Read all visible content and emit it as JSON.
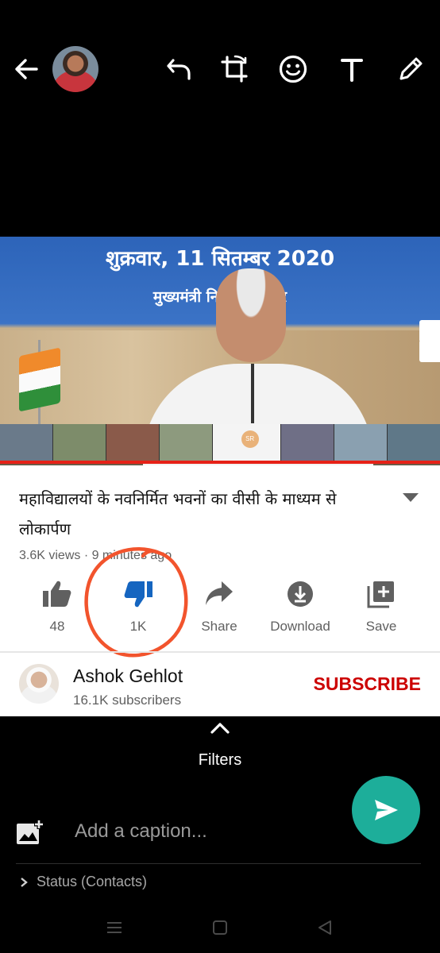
{
  "top_bar": {
    "back_icon": "arrow-left-icon",
    "profile_icon": "avatar",
    "tools": [
      "undo-icon",
      "crop-rotate-icon",
      "emoji-icon",
      "text-icon",
      "pencil-icon"
    ]
  },
  "video": {
    "banner_date": "शुक्रवार, 11 सितम्बर 2020",
    "banner_sub": "मुख्यमंत्री निवास, जयपुर",
    "progress": 1.0,
    "progress_color": "#e62117"
  },
  "details": {
    "title": "महाविद्यालयों के नवनिर्मित भवनों का वीसी के माध्यम से लोकार्पण",
    "meta": "3.6K views · 9 minutes ago",
    "actions": [
      {
        "icon": "thumb-up-icon",
        "label": "48"
      },
      {
        "icon": "thumb-down-icon",
        "label": "1K"
      },
      {
        "icon": "share-icon",
        "label": "Share"
      },
      {
        "icon": "download-icon",
        "label": "Download"
      },
      {
        "icon": "playlist-add-icon",
        "label": "Save"
      }
    ],
    "highlight_color": "#f2542d"
  },
  "channel": {
    "name": "Ashok Gehlot",
    "subscribers": "16.1K subscribers",
    "subscribe_label": "SUBSCRIBE",
    "subscribe_color": "#cc0000"
  },
  "composer": {
    "filters_label": "Filters",
    "caption_placeholder": "Add a caption...",
    "status_label": "Status (Contacts)",
    "send_color": "#1dae9a"
  }
}
